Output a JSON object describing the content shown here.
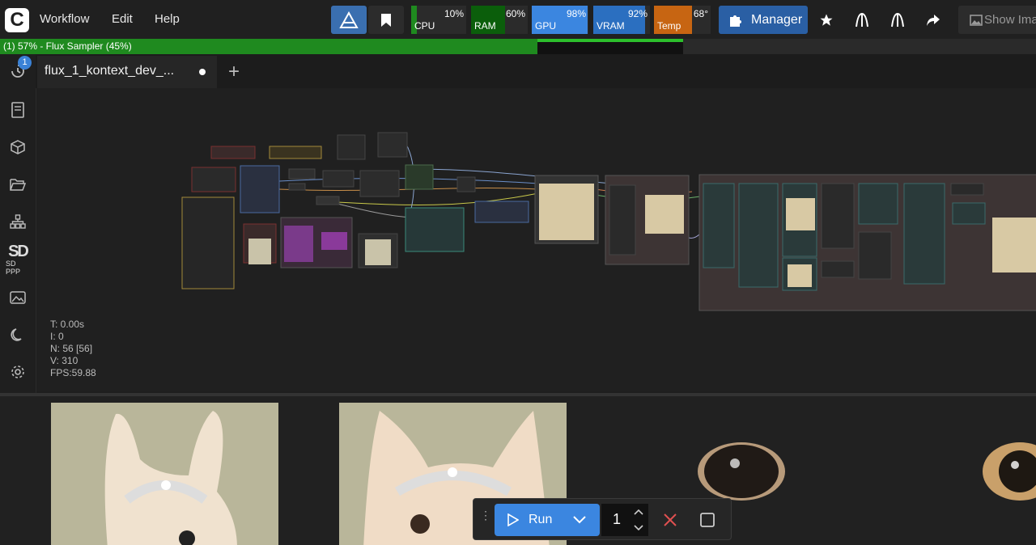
{
  "menu": [
    "Workflow",
    "Edit",
    "Help"
  ],
  "monitors": [
    {
      "label": "CPU",
      "percent": "10%",
      "color": "#1f8a1f"
    },
    {
      "label": "RAM",
      "percent": "60%",
      "color": "#0b5e0b"
    },
    {
      "label": "GPU",
      "percent": "98%",
      "color": "#3b86e0"
    },
    {
      "label": "VRAM",
      "percent": "92%",
      "color": "#2b6fc0"
    },
    {
      "label": "Temp",
      "percent": "68°",
      "color": "#c76512"
    }
  ],
  "manager_label": "Manager",
  "show_images_label": "Show Ima",
  "progress": {
    "text": "(1) 57% - Flux Sampler (45%)",
    "overall": 0.57,
    "node": 0.45
  },
  "sidebar": {
    "badge": "1"
  },
  "tab": {
    "name": "flux_1_kontext_dev_..."
  },
  "stats": [
    "T: 0.00s",
    "I: 0",
    "N: 56 [56]",
    "V: 310",
    "FPS:59.88"
  ],
  "run": {
    "label": "Run",
    "count": "1"
  },
  "sd_ppp_label": "SD PPP"
}
